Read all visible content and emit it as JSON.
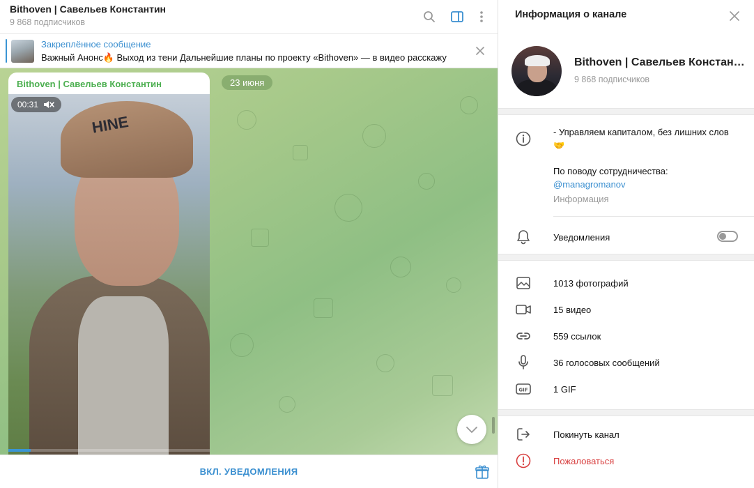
{
  "chat": {
    "title": "Bithoven | Савельев Константин",
    "subscribers": "9 868 подписчиков",
    "pinned": {
      "title": "Закреплённое сообщение",
      "text": "Важный Анонс🔥   Выход из тени  Дальнейшие планы по проекту «Bithoven»   — в видео расскажу"
    },
    "date_badge": "23 июня",
    "message": {
      "author": "Bithoven | Савельев Константин",
      "video_duration": "00:31",
      "video_progress": 0.11,
      "cap_text": "HINE"
    },
    "footer": {
      "notify_label": "ВКЛ. УВЕДОМЛЕНИЯ"
    }
  },
  "info": {
    "title": "Информация о канале",
    "name": "Bithoven | Савельев Константин",
    "subscribers": "9 868 подписчиков",
    "description": "- Управляем капиталом, без лишних слов 🤝",
    "cooperation": "По поводу сотрудничества:",
    "contact_link": "@managromanov",
    "section_caption": "Информация",
    "notifications_label": "Уведомления",
    "notifications_on": false,
    "media": [
      {
        "label": "1013 фотографий",
        "icon": "photo-icon"
      },
      {
        "label": "15 видео",
        "icon": "video-icon"
      },
      {
        "label": "559 ссылок",
        "icon": "link-icon"
      },
      {
        "label": "36 голосовых сообщений",
        "icon": "microphone-icon"
      },
      {
        "label": "1 GIF",
        "icon": "gif-icon"
      }
    ],
    "actions": {
      "leave": "Покинуть канал",
      "report": "Пожаловаться"
    }
  },
  "colors": {
    "accent": "#3a8fd0",
    "author": "#4caf50",
    "danger": "#d84040"
  }
}
